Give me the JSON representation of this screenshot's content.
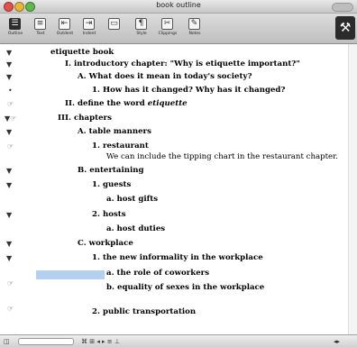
{
  "window": {
    "title": "book outline"
  },
  "toolbar": {
    "items": [
      {
        "label": "Outline",
        "icon": "outline-icon"
      },
      {
        "label": "Text",
        "icon": "text-icon"
      },
      {
        "label": "Outdent",
        "icon": "outdent-icon"
      },
      {
        "label": "Indent",
        "icon": "indent-icon"
      },
      {
        "label": "",
        "icon": "note-icon"
      },
      {
        "label": "Style",
        "icon": "style-icon"
      },
      {
        "label": "Clippings",
        "icon": "clippings-icon"
      },
      {
        "label": "Notes",
        "icon": "notes-icon"
      }
    ]
  },
  "outline": {
    "rows": [
      {
        "text": "etiquette book"
      },
      {
        "text": "I. introductory chapter: \"Why is etiquette important?\""
      },
      {
        "text": "A. What does it mean in today's society?"
      },
      {
        "text": "1. How has it changed? Why has it changed?"
      },
      {
        "text_a": "II. define the word ",
        "text_b": "etiquette"
      },
      {
        "text": "III. chapters"
      },
      {
        "text": "A. table manners"
      },
      {
        "text": "1. restaurant"
      },
      {
        "text": "We can include the tipping chart in the restaurant chapter."
      },
      {
        "text": "B. entertaining"
      },
      {
        "text": "1. guests"
      },
      {
        "text": "a. host gifts"
      },
      {
        "text": "2. hosts"
      },
      {
        "text": "a. host duties"
      },
      {
        "text": "C. workplace"
      },
      {
        "text": "1. the new informality in the workplace"
      },
      {
        "text": "a. the role of coworkers"
      },
      {
        "text": "b. equality of sexes in the workplace"
      },
      {
        "text": "2. public transportation"
      }
    ]
  }
}
